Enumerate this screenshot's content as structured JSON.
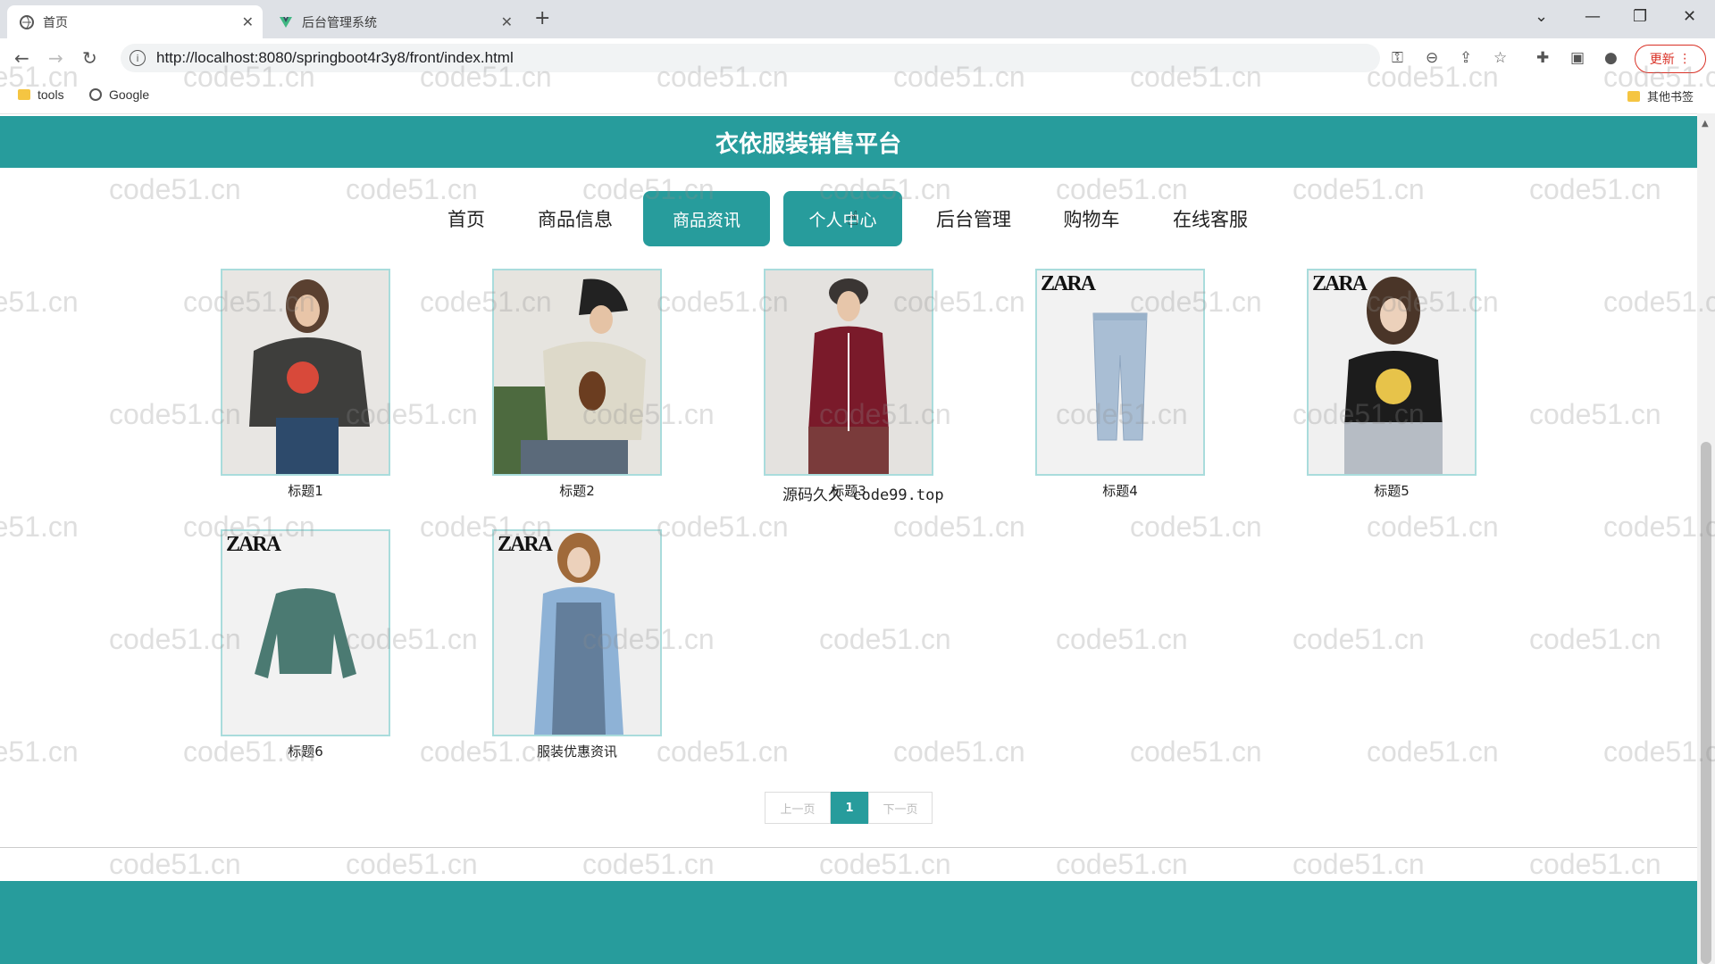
{
  "browser": {
    "tabs": [
      {
        "title": "首页",
        "active": true
      },
      {
        "title": "后台管理系统",
        "active": false
      }
    ],
    "url": "http://localhost:8080/springboot4r3y8/front/index.html",
    "update_label": "更新",
    "bookmarks": [
      {
        "label": "tools",
        "icon": "folder-icon"
      },
      {
        "label": "Google",
        "icon": "globe-icon"
      }
    ],
    "other_bookmarks": "其他书签"
  },
  "site": {
    "title": "衣依服装销售平台",
    "accent": "#279c9c",
    "nav": [
      "首页",
      "商品信息",
      "商品资讯",
      "个人中心",
      "后台管理",
      "购物车",
      "在线客服"
    ]
  },
  "products": [
    {
      "caption": "标题1"
    },
    {
      "caption": "标题2"
    },
    {
      "caption": "标题3"
    },
    {
      "caption": "标题4",
      "brand": "ZARA"
    },
    {
      "caption": "标题5",
      "brand": "ZARA"
    },
    {
      "caption": "标题6",
      "brand": "ZARA"
    },
    {
      "caption": "服装优惠资讯",
      "brand": "ZARA"
    }
  ],
  "overlay_text": "源码久久 code99.top",
  "pager": {
    "prev": "上一页",
    "current": "1",
    "next": "下一页"
  },
  "watermark": "code51.cn"
}
